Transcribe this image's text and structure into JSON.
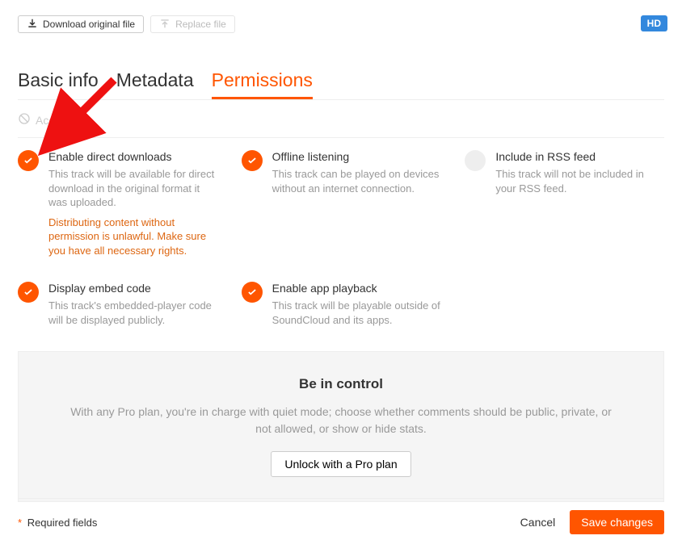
{
  "toolbar": {
    "download_label": "Download original file",
    "replace_label": "Replace file",
    "hd_badge": "HD"
  },
  "tabs": {
    "basic_info": "Basic info",
    "metadata": "Metadata",
    "permissions": "Permissions"
  },
  "access_label": "Acc",
  "permissions": {
    "direct_downloads": {
      "title": "Enable direct downloads",
      "desc": "This track will be available for direct download in the original format it was uploaded.",
      "warn": "Distributing content without permission is unlawful. Make sure you have all necessary rights.",
      "checked": true
    },
    "offline": {
      "title": "Offline listening",
      "desc": "This track can be played on devices without an internet connection.",
      "checked": true
    },
    "rss": {
      "title": "Include in RSS feed",
      "desc": "This track will not be included in your RSS feed.",
      "checked": false
    },
    "embed": {
      "title": "Display embed code",
      "desc": "This track's embedded-player code will be displayed publicly.",
      "checked": true
    },
    "app_playback": {
      "title": "Enable app playback",
      "desc": "This track will be playable outside of SoundCloud and its apps.",
      "checked": true
    }
  },
  "pro": {
    "title": "Be in control",
    "desc": "With any Pro plan, you're in charge with quiet mode; choose whether comments should be public, private, or not allowed, or show or hide stats.",
    "cta": "Unlock with a Pro plan"
  },
  "footer": {
    "required_label": "Required fields",
    "cancel": "Cancel",
    "save": "Save changes"
  },
  "colors": {
    "accent": "#f50"
  }
}
